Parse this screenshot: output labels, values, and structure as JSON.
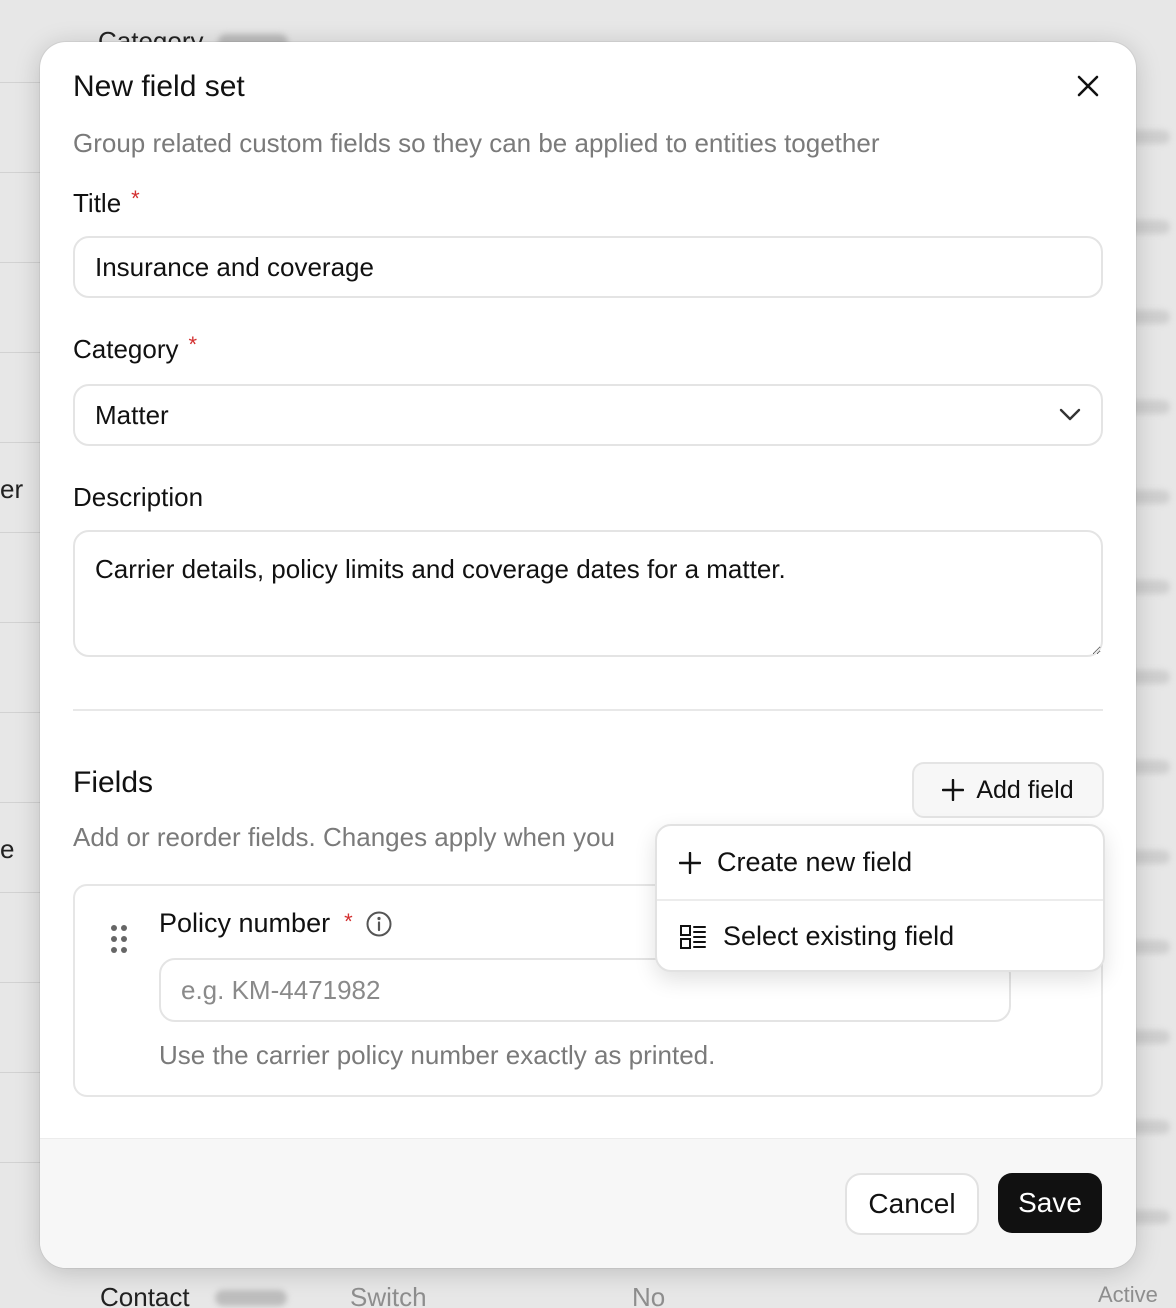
{
  "background": {
    "top_label": "Category",
    "left_fragments": [
      "er",
      "e"
    ],
    "bottom_row": {
      "name": "Contact",
      "type": "Switch",
      "required": "No",
      "status": "Active"
    }
  },
  "modal": {
    "title": "New field set",
    "subtitle": "Group related custom fields so they can be applied to entities together",
    "close_icon": "close-icon",
    "title_field": {
      "label": "Title",
      "required_mark": "*",
      "value": "Insurance and coverage"
    },
    "category_field": {
      "label": "Category",
      "required_mark": "*",
      "value": "Matter",
      "icon": "chevron-down-icon"
    },
    "description_field": {
      "label": "Description",
      "value": "Carrier details, policy limits and coverage dates for a matter."
    },
    "fields_section": {
      "title": "Fields",
      "subtitle": "Add or reorder fields. Changes apply when you",
      "add_button": {
        "label": "Add field",
        "icon": "plus-icon"
      },
      "menu": [
        {
          "label": "Create new field",
          "icon": "plus-icon"
        },
        {
          "label": "Select existing field",
          "icon": "list-select-icon"
        }
      ],
      "cards": [
        {
          "name": "Policy number",
          "required_mark": "*",
          "placeholder": "e.g. KM-4471982",
          "help": "Use the carrier policy number exactly as printed."
        }
      ]
    },
    "footer": {
      "cancel_label": "Cancel",
      "save_label": "Save"
    }
  },
  "colors": {
    "accent": "#111111",
    "required": "#d32f2f",
    "muted_text": "#7a7a7a",
    "backdrop": "#e6e6e6"
  }
}
